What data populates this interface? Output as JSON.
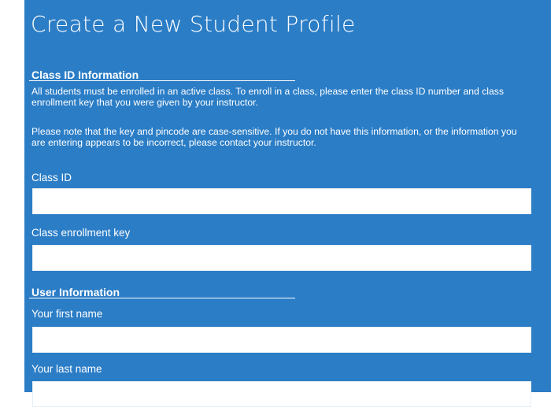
{
  "page": {
    "title": "Create a New Student Profile"
  },
  "class_section": {
    "heading": "Class ID Information",
    "paragraph1": "All students must be enrolled in an active class. To enroll in a class, please enter the class ID number and class enrollment key that you were given by your instructor.",
    "paragraph2": "Please note that the key and pincode are case-sensitive. If you do not have this information, or the information you are entering appears to be incorrect, please contact your instructor.",
    "class_id": {
      "label": "Class ID",
      "value": "",
      "placeholder": ""
    },
    "enrollment_key": {
      "label": "Class enrollment key",
      "value": "",
      "placeholder": ""
    }
  },
  "user_section": {
    "heading": "User Information",
    "first_name": {
      "label": "Your first name",
      "value": "",
      "placeholder": ""
    },
    "last_name": {
      "label": "Your last name",
      "value": "",
      "placeholder": ""
    }
  },
  "colors": {
    "background_blue": "#2b7dc6",
    "text": "#ffffff",
    "input_background": "#ffffff"
  }
}
